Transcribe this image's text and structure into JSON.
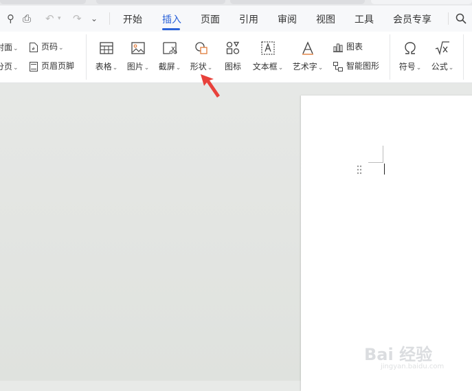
{
  "tabs": {
    "items": [
      {
        "label": "开始"
      },
      {
        "label": "插入"
      },
      {
        "label": "页面"
      },
      {
        "label": "引用"
      },
      {
        "label": "审阅"
      },
      {
        "label": "视图"
      },
      {
        "label": "工具"
      },
      {
        "label": "会员专享"
      }
    ],
    "active": "插入"
  },
  "ribbon": {
    "cover_label": "封面",
    "page_number_label": "页码",
    "page_break_label": "分页",
    "header_footer_label": "页眉页脚",
    "table_label": "表格",
    "picture_label": "图片",
    "screenshot_label": "截屏",
    "shape_label": "形状",
    "icon_label": "图标",
    "textbox_label": "文本框",
    "wordart_label": "艺术字",
    "chart_label": "图表",
    "smartart_label": "智能图形",
    "symbol_label": "符号",
    "formula_label": "公式"
  },
  "watermark": {
    "logo": "Bai 经验",
    "sub": "jingyan.baidu.com"
  },
  "colors": {
    "accent": "#2b62d8",
    "arrow": "#e8413b",
    "canvas": "#e4e6e3"
  }
}
